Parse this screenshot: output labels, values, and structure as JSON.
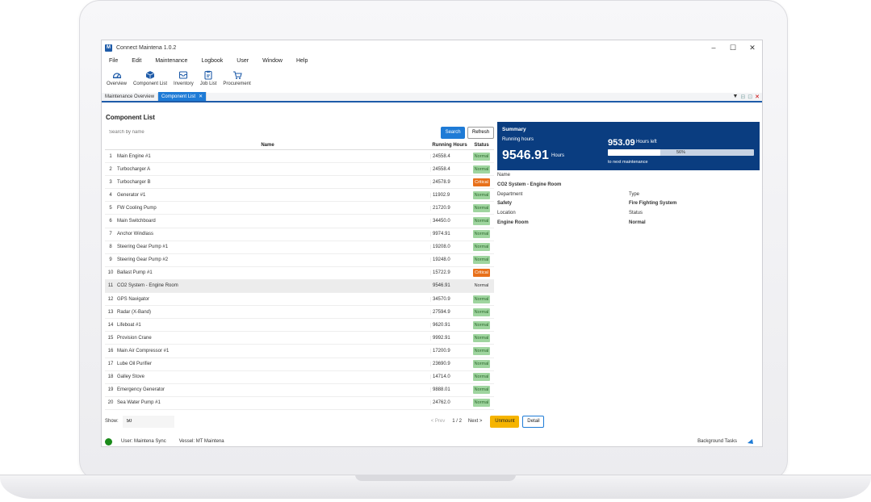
{
  "window": {
    "title": "Connect Maintena 1.0.2",
    "logo": "M",
    "controls": [
      "–",
      "☐",
      "✕"
    ]
  },
  "menu": [
    "File",
    "Edit",
    "Maintenance",
    "Logbook",
    "User",
    "Window",
    "Help"
  ],
  "toolbar": [
    {
      "label": "Overview",
      "icon": "gauge-icon"
    },
    {
      "label": "Component List",
      "icon": "cube-icon"
    },
    {
      "label": "Inventory",
      "icon": "box-icon"
    },
    {
      "label": "Job List",
      "icon": "clipboard-icon"
    },
    {
      "label": "Procurement",
      "icon": "cart-icon"
    }
  ],
  "tabs": [
    {
      "label": "Maintenance Overview",
      "active": false
    },
    {
      "label": "Component List",
      "active": true,
      "close": "✕"
    }
  ],
  "tab_controls": [
    "▼",
    "⊟",
    "⊡",
    "✕"
  ],
  "list": {
    "title": "Component List",
    "search_placeholder": "Search by name",
    "search_btn": "Search",
    "refresh_btn": "Refresh",
    "headers": {
      "name": "Name",
      "hours": "Running Hours",
      "status": "Status"
    },
    "rows": [
      {
        "idx": "1",
        "name": "Main Engine #1",
        "hours": "24558.4",
        "status": "Normal"
      },
      {
        "idx": "2",
        "name": "Turbocharger A",
        "hours": "24558.4",
        "status": "Normal"
      },
      {
        "idx": "3",
        "name": "Turbocharger B",
        "hours": "24578.9",
        "status": "Critical"
      },
      {
        "idx": "4",
        "name": "Generator #1",
        "hours": "11902.9",
        "status": "Normal"
      },
      {
        "idx": "5",
        "name": "FW Cooling Pump",
        "hours": "21720.9",
        "status": "Normal"
      },
      {
        "idx": "6",
        "name": "Main Switchboard",
        "hours": "34450.0",
        "status": "Normal"
      },
      {
        "idx": "7",
        "name": "Anchor Windlass",
        "hours": "9974.91",
        "status": "Normal"
      },
      {
        "idx": "8",
        "name": "Steering Gear Pump #1",
        "hours": "19208.0",
        "status": "Normal"
      },
      {
        "idx": "9",
        "name": "Steering Gear Pump #2",
        "hours": "19248.0",
        "status": "Normal"
      },
      {
        "idx": "10",
        "name": "Ballast Pump #1",
        "hours": "15722.9",
        "status": "Critical"
      },
      {
        "idx": "11",
        "name": "CO2 System - Engine Room",
        "hours": "9546.91",
        "status": "Normal",
        "selected": true
      },
      {
        "idx": "12",
        "name": "GPS Navigator",
        "hours": "34570.9",
        "status": "Normal"
      },
      {
        "idx": "13",
        "name": "Radar (X-Band)",
        "hours": "27594.9",
        "status": "Normal"
      },
      {
        "idx": "14",
        "name": "Lifeboat #1",
        "hours": "9620.91",
        "status": "Normal"
      },
      {
        "idx": "15",
        "name": "Provision Crane",
        "hours": "9992.91",
        "status": "Normal"
      },
      {
        "idx": "16",
        "name": "Main Air Compressor #1",
        "hours": "17200.9",
        "status": "Normal"
      },
      {
        "idx": "17",
        "name": "Lube Oil Purifier",
        "hours": "23690.9",
        "status": "Normal"
      },
      {
        "idx": "18",
        "name": "Galley Stove",
        "hours": "14714.0",
        "status": "Normal"
      },
      {
        "idx": "19",
        "name": "Emergency Generator",
        "hours": "9888.01",
        "status": "Normal"
      },
      {
        "idx": "20",
        "name": "Sea Water Pump #1",
        "hours": "24762.0",
        "status": "Normal"
      }
    ]
  },
  "pager": {
    "show_label": "Show:",
    "show_value": "50",
    "prev": "< Prev",
    "page": "1",
    "of": "/",
    "total": "2",
    "next": "Next >",
    "unmount": "Unmount",
    "detail": "Detail"
  },
  "summary": {
    "title": "Summary",
    "running_label": "Running hours",
    "running_value": "9546.91",
    "running_unit": "Hours",
    "left_value": "953.09",
    "left_unit": "Hours left",
    "progress_pct": "56%",
    "progress_frac": 0.36,
    "note": "to next maintenance"
  },
  "details": {
    "name_label": "Name",
    "name_value": "CO2 System - Engine Room",
    "department_label": "Department",
    "department_value": "Safety",
    "type_label": "Type",
    "type_value": "Fire Fighting System",
    "location_label": "Location",
    "location_value": "Engine Room",
    "status_label": "Status",
    "status_value": "Normal"
  },
  "statusbar": {
    "user": "User: Maintena Sync",
    "vessel": "Vessel: MT Maintena",
    "tasks": "Background Tasks"
  },
  "colors": {
    "accent": "#1e7bd6",
    "brand": "#0a3d80",
    "normal": "#9fd59f",
    "critical": "#e8701a",
    "unmount": "#f6b400",
    "online": "#1a8a1a"
  }
}
